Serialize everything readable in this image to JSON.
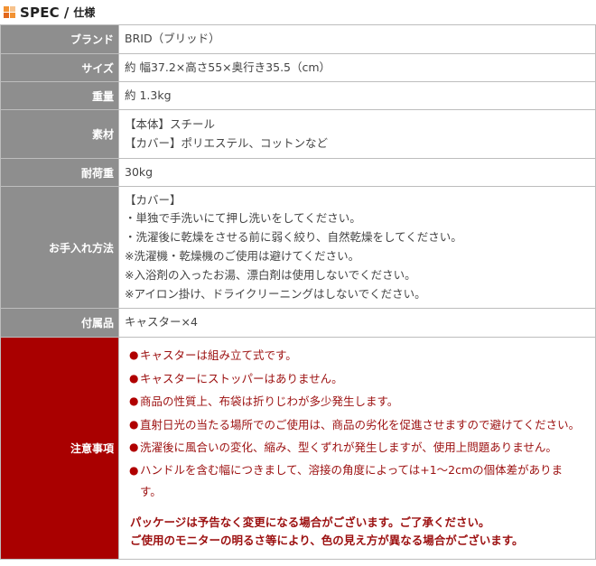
{
  "header": {
    "title": "SPEC",
    "separator": "/",
    "subtitle": "仕様"
  },
  "rows": [
    {
      "label": "ブランド",
      "lines": [
        "BRID（ブリッド）"
      ]
    },
    {
      "label": "サイズ",
      "lines": [
        "約 幅37.2×高さ55×奥行き35.5（cm）"
      ]
    },
    {
      "label": "重量",
      "lines": [
        "約 1.3kg"
      ]
    },
    {
      "label": "素材",
      "lines": [
        "【本体】スチール",
        "【カバー】ポリエステル、コットンなど"
      ]
    },
    {
      "label": "耐荷重",
      "lines": [
        "30kg"
      ]
    },
    {
      "label": "お手入れ方法",
      "lines": [
        "【カバー】",
        "・単独で手洗いにて押し洗いをしてください。",
        "・洗濯後に乾燥をさせる前に弱く絞り、自然乾燥をしてください。",
        "※洗濯機・乾燥機のご使用は避けてください。",
        "※入浴剤の入ったお湯、漂白剤は使用しないでください。",
        "※アイロン掛け、ドライクリーニングはしないでください。"
      ]
    },
    {
      "label": "付属品",
      "lines": [
        "キャスター×4"
      ]
    }
  ],
  "caution": {
    "label": "注意事項",
    "items": [
      "キャスターは組み立て式です。",
      "キャスターにストッパーはありません。",
      "商品の性質上、布袋は折りじわが多少発生します。",
      "直射日光の当たる場所でのご使用は、商品の劣化を促進させますので避けてください。",
      "洗濯後に風合いの変化、縮み、型くずれが発生しますが、使用上問題ありません。",
      "ハンドルを含む幅につきまして、溶接の角度によっては+1～2cmの個体差がありま",
      "す。"
    ],
    "bold_lines": [
      "パッケージは予告なく変更になる場合がございます。ご了承ください。",
      "ご使用のモニターの明るさ等により、色の見え方が異なる場合がございます。"
    ]
  }
}
